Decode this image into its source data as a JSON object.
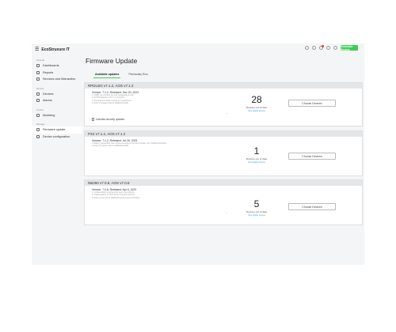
{
  "brand": {
    "menu_icon": "hamburger-icon",
    "name": "EcoStruxure IT"
  },
  "topbar": {
    "icons": [
      "search-icon",
      "help-icon",
      "notification-icon",
      "settings-icon",
      "user-icon"
    ],
    "logo_text": "Schneider Electric"
  },
  "sidebar": {
    "sections": [
      {
        "label": "General",
        "items": [
          {
            "label": "Dashboards",
            "icon": "dashboard-icon"
          },
          {
            "label": "Reports",
            "icon": "report-icon"
          },
          {
            "label": "Services and Warranties",
            "icon": "services-icon"
          }
        ]
      },
      {
        "label": "Monitor",
        "items": [
          {
            "label": "Devices",
            "icon": "device-icon"
          },
          {
            "label": "Alarms",
            "icon": "alarm-icon"
          }
        ]
      },
      {
        "label": "Predict",
        "items": [
          {
            "label": "Modeling",
            "icon": "modeling-icon"
          }
        ]
      },
      {
        "label": "Manage",
        "items": [
          {
            "label": "Firmware update",
            "icon": "firmware-icon",
            "active": true
          },
          {
            "label": "Device configuration",
            "icon": "config-icon"
          }
        ]
      }
    ]
  },
  "main": {
    "title": "Firmware Update",
    "tabs": [
      {
        "label": "Available updates",
        "active": true
      },
      {
        "label": "Previously Run",
        "active": false
      }
    ],
    "cards": [
      {
        "header": "RPDU2G v7.1.2, AOS v7.1.2",
        "version": "Version: 7.1.2, Released: Dec 20, 2023",
        "notes": [
          "1. SNMP trap numbers are now configurable to help",
          "2. HTTPS defaults to TLS 1.3 encryption",
          "3. Fine-grained control of customer requirements",
          "4. Refer to release notes for additional details"
        ],
        "count": "28",
        "count_label": "Devices out of date",
        "link": "View eligible devices",
        "button": "Choose Devices",
        "checkbox_label": "Includes security updates"
      },
      {
        "header": "PX2 v7.1.2, AOS v7.1.2",
        "version": "Version: 7.1.2, Released: Jul 26, 2023",
        "notes": [
          "1. Battery Temperature now reported correctly on the Web Interface, CLI, SNMP and Modbus",
          "2. Refer to release notes for additional details"
        ],
        "count": "1",
        "count_label": "Devices out of date",
        "link": "View eligible devices",
        "button": "Choose Devices"
      },
      {
        "header": "NB250 v7.0.8, AOS v7.0.8",
        "version": "Version: 7.0.8, Released: Apr 6, 2023",
        "notes": [
          "1. Includes ability to add security users via config file",
          "2. Implementation of TFTP Server Transport Security",
          "3. Refer to your unit for additional security issue information"
        ],
        "count": "5",
        "count_label": "Devices out of date",
        "link": "View eligible devices",
        "button": "Choose Devices"
      }
    ]
  }
}
